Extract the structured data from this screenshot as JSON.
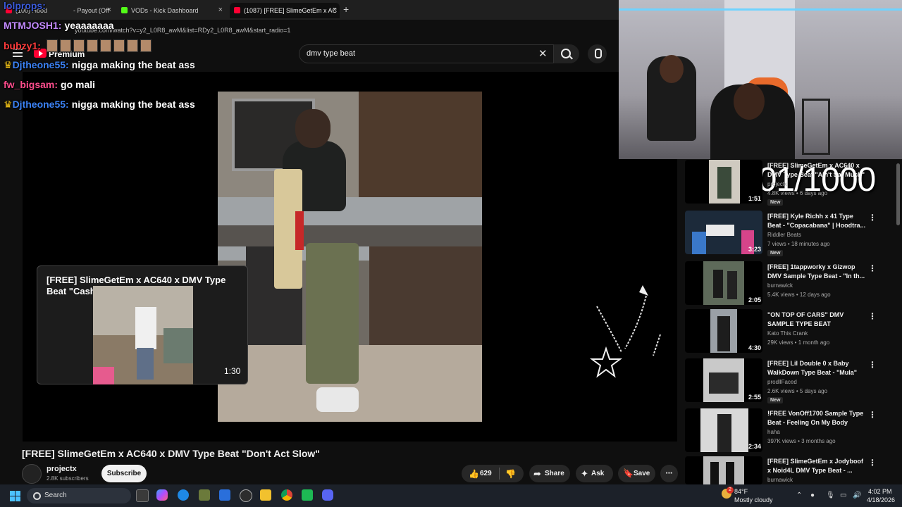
{
  "browser": {
    "tabs": [
      {
        "label": "(100) Hood",
        "color": "#ff0033"
      },
      {
        "label": "- Payout (Off",
        "color": "#1a73e8"
      },
      {
        "label": "VODs - Kick Dashboard",
        "color": "#53fc18"
      },
      {
        "label": "(1087) [FREE] SlimeGetEm x AC",
        "color": "#ff0033"
      }
    ],
    "url": "youtube.com/watch?v=y2_L0R8_awM&list=RDy2_L0R8_awM&start_radio=1"
  },
  "youtube": {
    "logo_text": "Premium",
    "search_value": "dmv type beat"
  },
  "chat": [
    {
      "user": "lolprops:",
      "message": "",
      "color": "#3b5bdb"
    },
    {
      "user": "MTMJOSH1:",
      "message": "yeaaaaaaa",
      "color": "#c38aff"
    },
    {
      "user": "bubzy1:",
      "message": "",
      "color": "#ff3b3b"
    },
    {
      "user": "Djtheone55:",
      "message": "nigga making the beat ass",
      "color": "#3b82f6"
    },
    {
      "user": "fw_bigsam:",
      "message": "go mali",
      "color": "#ff4d8d"
    },
    {
      "user": "Djtheone55:",
      "message": "nigga making the beat ass",
      "color": "#3b82f6"
    }
  ],
  "endcard": {
    "title": "[FREE] SlimeGetEm x AC640 x DMV Type Beat \"Cash Hid Me\"",
    "duration": "1:30"
  },
  "video": {
    "title": "[FREE] SlimeGetEm x AC640 x DMV Type Beat \"Don't Act Slow\"",
    "channel": "projectx",
    "subscribers": "2.8K subscribers",
    "subscribe_label": "Subscribe",
    "likes": "629",
    "share_label": "Share",
    "ask_label": "Ask",
    "save_label": "Save"
  },
  "overlay": {
    "counter": "801/1000"
  },
  "recommendations": [
    {
      "title": "[FREE] SlimeGetEm x AC640 x DMV Type Beat \"Ain't Sat Much\"",
      "channel": "projectx",
      "meta": "4.8K views • 6 days ago",
      "duration": "1:51",
      "is_new": true,
      "badge": "New"
    },
    {
      "title": "[FREE] Kyle Richh x 41 Type Beat - \"Copacabana\" | Hoodtra...",
      "channel": "Riddler Beats",
      "meta": "7 views • 18 minutes ago",
      "duration": "3:23",
      "is_new": true,
      "badge": "New"
    },
    {
      "title": "[FREE] 1tappworky x Gizwop DMV Sample Type Beat - \"In th...",
      "channel": "burnawick",
      "meta": "5.4K views • 12 days ago",
      "duration": "2:05",
      "is_new": false
    },
    {
      "title": "\"ON TOP OF CARS\" DMV SAMPLE TYPE BEAT",
      "channel": "Kato This Crank",
      "meta": "29K views • 1 month ago",
      "duration": "4:30",
      "is_new": false
    },
    {
      "title": "[FREE] Lil Double 0 x Baby WalkDown Type Beat - \"Mula\"",
      "channel": "prodllFaced",
      "meta": "2.6K views • 5 days ago",
      "duration": "2:55",
      "is_new": true,
      "badge": "New"
    },
    {
      "title": "!FREE VonOff1700 Sample Type Beat - Feeling On My Body",
      "channel": "haha",
      "meta": "397K views • 3 months ago",
      "duration": "2:34",
      "is_new": false
    },
    {
      "title": "[FREE] SlimeGetEm x Jodyboof x Noid4L DMV Type Beat - ...",
      "channel": "burnawick",
      "meta": "",
      "duration": "",
      "is_new": false
    }
  ],
  "taskbar": {
    "search_label": "Search",
    "weather_temp": "84°F",
    "weather_desc": "Mostly cloudy",
    "time": "4:02 PM",
    "date": "4/18/2026",
    "notification_count": "2"
  }
}
